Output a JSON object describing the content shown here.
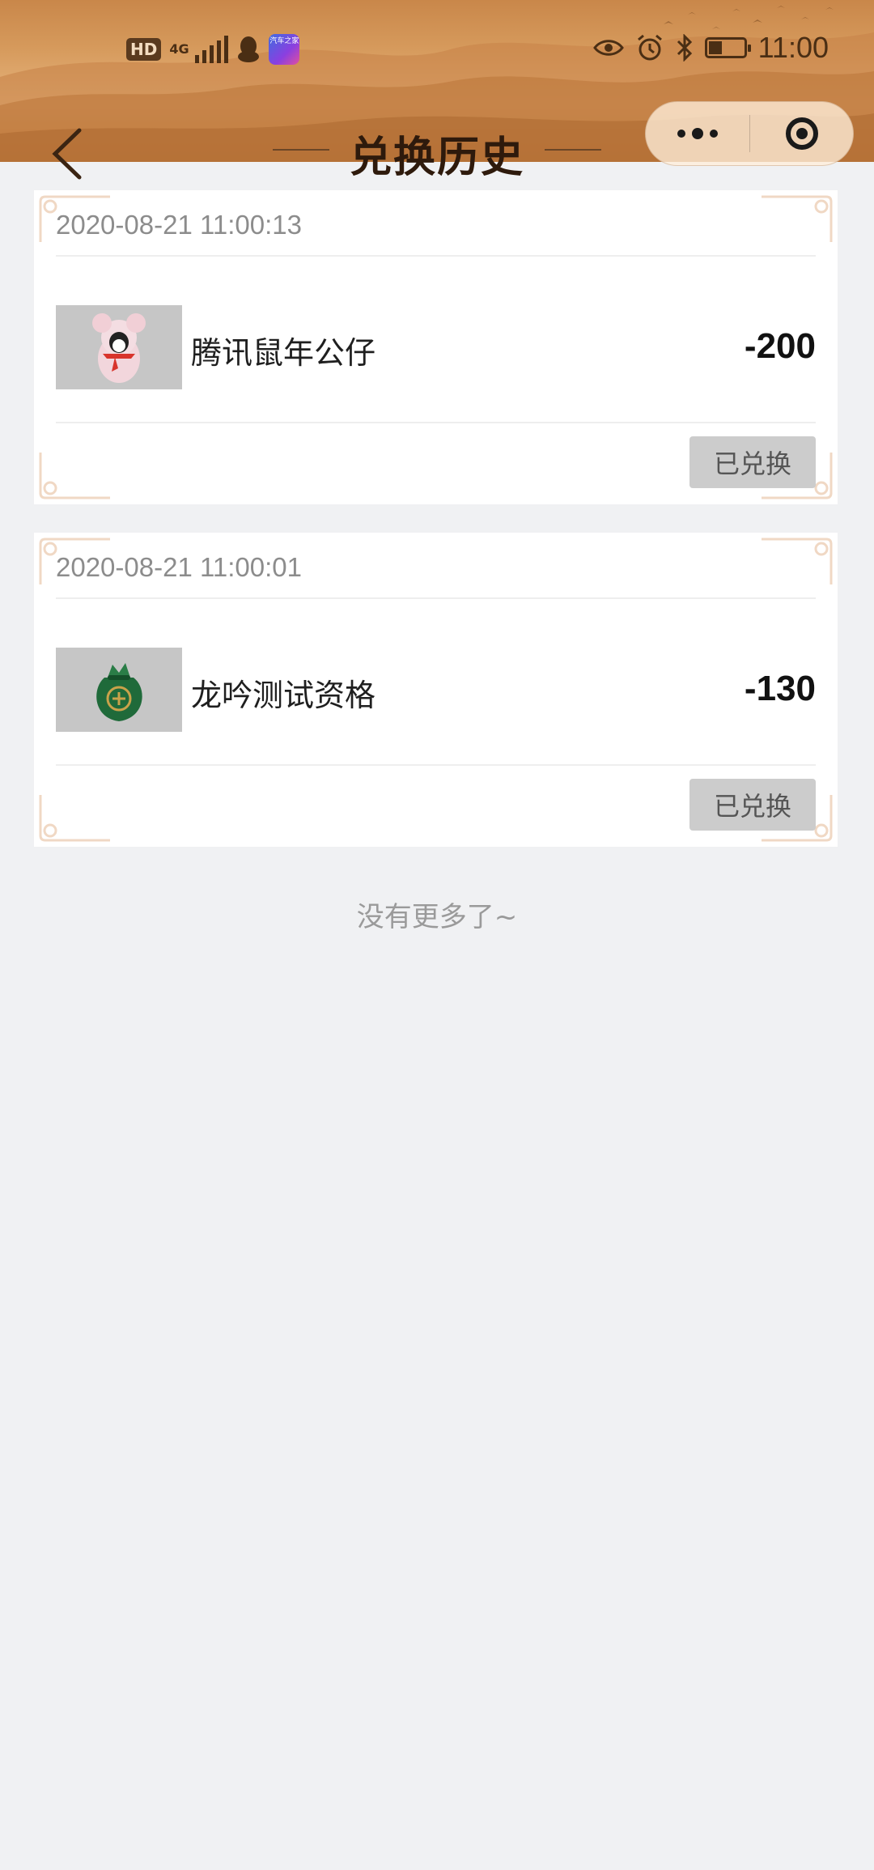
{
  "status_bar": {
    "hd_label": "HD",
    "network_label": "4G",
    "app_badge_text": "汽车之家",
    "time": "11:00",
    "icons": [
      "hd-icon",
      "signal-icon",
      "qq-icon",
      "app-icon",
      "eye-icon",
      "alarm-icon",
      "bluetooth-icon",
      "battery-icon"
    ]
  },
  "nav": {
    "title": "兑换历史",
    "back_icon": "chevron-left-icon",
    "menu_icon": "more-dots-icon",
    "close_icon": "target-circle-icon"
  },
  "records": [
    {
      "time": "2020-08-21 11:00:13",
      "name": "腾讯鼠年公仔",
      "points": "-200",
      "status": "已兑换",
      "image": "mouse-plush-image"
    },
    {
      "time": "2020-08-21 11:00:01",
      "name": "龙吟测试资格",
      "points": "-130",
      "status": "已兑换",
      "image": "green-pouch-image"
    }
  ],
  "footer": {
    "no_more": "没有更多了~"
  },
  "colors": {
    "header_brown": "#d69a5c",
    "title_dark": "#2e1a0c",
    "page_bg": "#f0f1f3",
    "card_bg": "#ffffff",
    "muted_text": "#8c8c8c",
    "status_btn_bg": "#cccccc"
  }
}
